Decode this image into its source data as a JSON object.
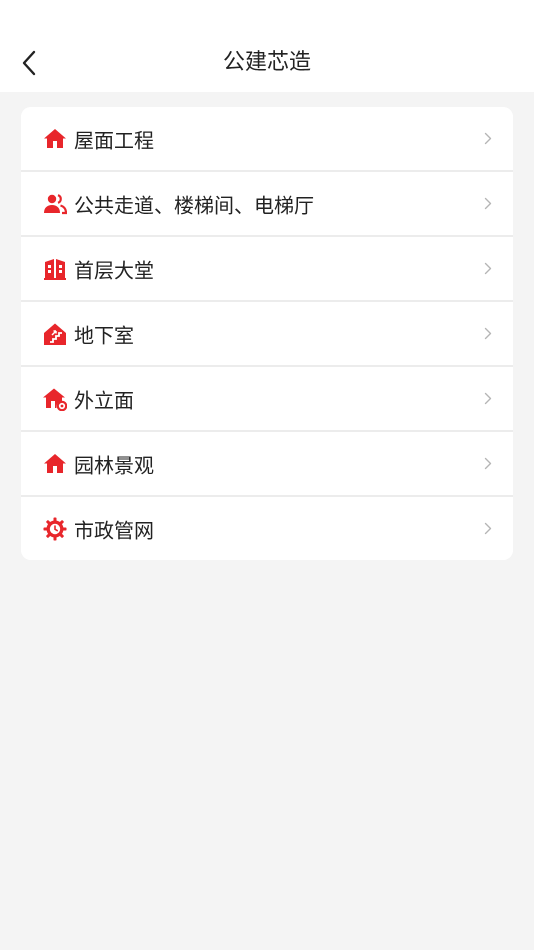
{
  "header": {
    "title": "公建芯造"
  },
  "colors": {
    "accent": "#e8262b",
    "text": "#222222",
    "chevron": "#b5b5b5",
    "background": "#f4f4f4"
  },
  "items": [
    {
      "label": "屋面工程",
      "icon": "house-icon"
    },
    {
      "label": "公共走道、楼梯间、电梯厅",
      "icon": "users-icon"
    },
    {
      "label": "首层大堂",
      "icon": "building-icon"
    },
    {
      "label": "地下室",
      "icon": "basement-stairs-icon"
    },
    {
      "label": "外立面",
      "icon": "house-gear-icon"
    },
    {
      "label": "园林景观",
      "icon": "house-icon"
    },
    {
      "label": "市政管网",
      "icon": "gear-clock-icon"
    }
  ]
}
